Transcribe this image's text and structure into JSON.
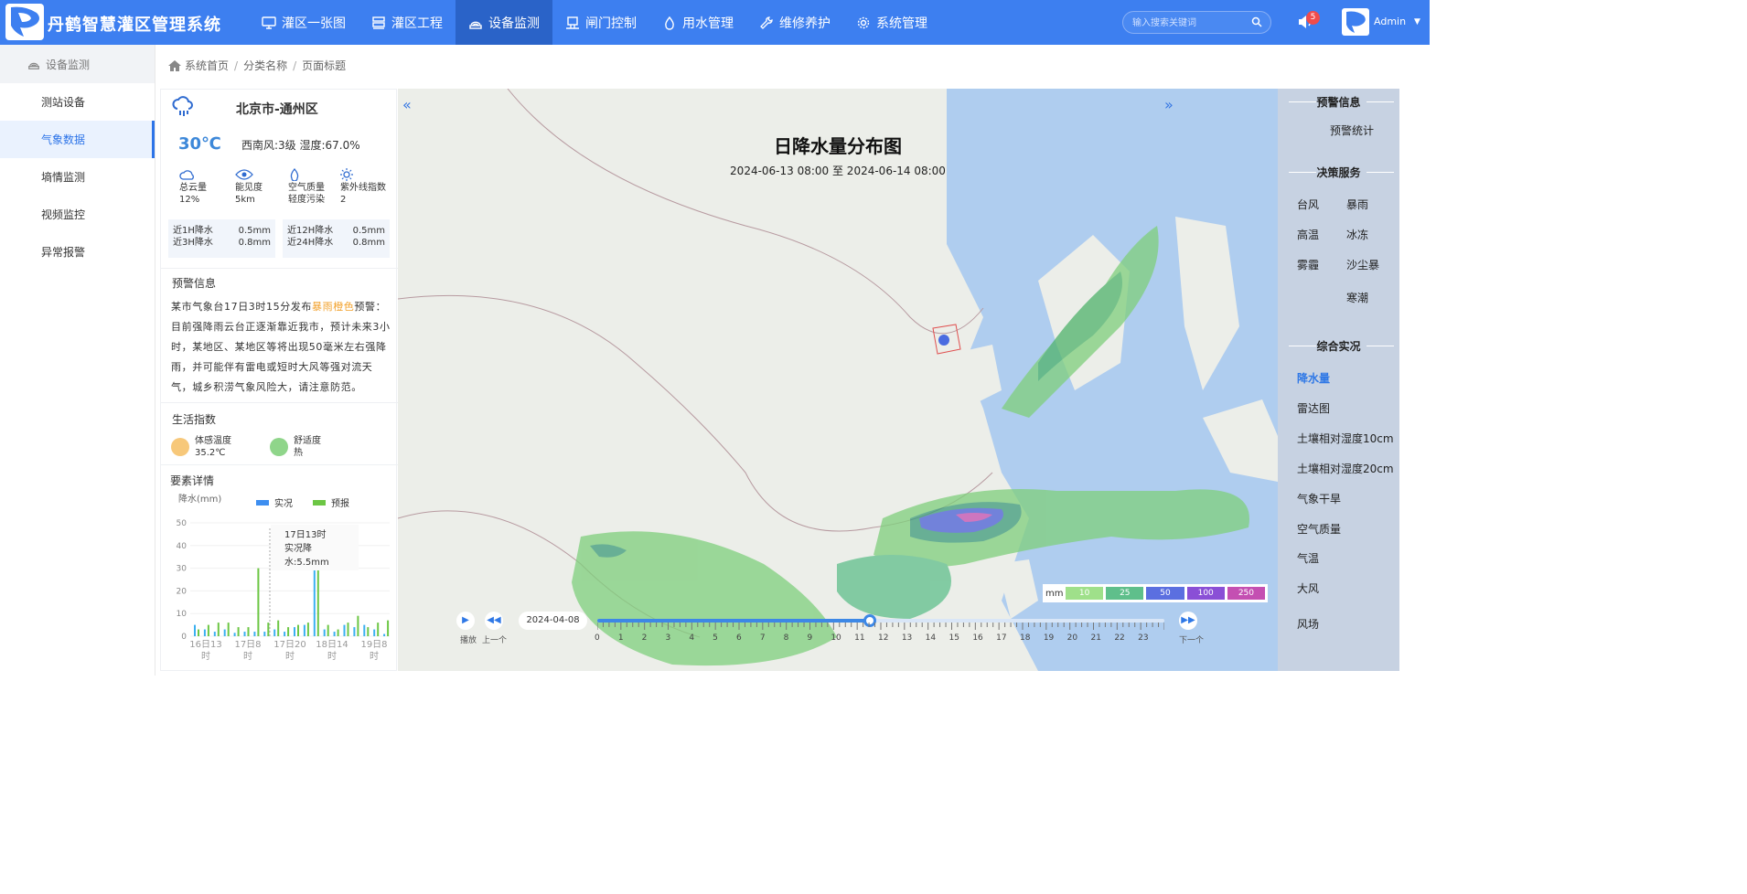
{
  "app": {
    "title": "丹鹤智慧灌区管理系统"
  },
  "nav": [
    {
      "label": "灌区一张图",
      "icon": "monitor-icon"
    },
    {
      "label": "灌区工程",
      "icon": "server-icon"
    },
    {
      "label": "设备监测",
      "icon": "broadcast-icon",
      "active": true
    },
    {
      "label": "闸门控制",
      "icon": "gate-icon"
    },
    {
      "label": "用水管理",
      "icon": "water-drop-icon"
    },
    {
      "label": "维修养护",
      "icon": "wrench-icon"
    },
    {
      "label": "系统管理",
      "icon": "gear-icon"
    }
  ],
  "search": {
    "placeholder": "输入搜索关键词"
  },
  "notifications": {
    "count": "5"
  },
  "user": {
    "name": "Admin"
  },
  "sidebar": {
    "header": "设备监测",
    "items": [
      {
        "label": "测站设备"
      },
      {
        "label": "气象数据",
        "active": true
      },
      {
        "label": "墒情监测"
      },
      {
        "label": "视频监控"
      },
      {
        "label": "异常报警"
      }
    ]
  },
  "breadcrumb": [
    "系统首页",
    "分类名称",
    "页面标题"
  ],
  "weather": {
    "location": "北京市-通州区",
    "temperature": "30℃",
    "wind_humidity": "西南风:3级 湿度:67.0%",
    "metrics": [
      {
        "label": "总云量",
        "value": "12%",
        "icon": "cloud-icon"
      },
      {
        "label": "能见度",
        "value": "5km",
        "icon": "eye-icon"
      },
      {
        "label": "空气质量",
        "value": "轻度污染",
        "icon": "air-icon"
      },
      {
        "label": "紫外线指数",
        "value": "2",
        "icon": "sun-icon"
      }
    ],
    "rain": [
      {
        "label": "近1H降水",
        "value": "0.5mm"
      },
      {
        "label": "近3H降水",
        "value": "0.8mm"
      },
      {
        "label": "近12H降水",
        "value": "0.5mm"
      },
      {
        "label": "近24H降水",
        "value": "0.8mm"
      }
    ]
  },
  "warning": {
    "title": "预警信息",
    "text_before": "某市气象台17日3时15分发布",
    "highlight": "暴雨橙色",
    "text_after": "预警：目前强降雨云台正逐渐靠近我市，预计未来3小时，某地区、某地区等将出现50毫米左右强降雨，并可能伴有雷电或短时大风等强对流天气，城乡积涝气象风险大，请注意防范。",
    "highlight_color": "#f2a12b"
  },
  "life": {
    "title": "生活指数",
    "items": [
      {
        "label": "体感温度",
        "value": "35.2℃",
        "color": "#f7c87a"
      },
      {
        "label": "舒适度",
        "value": "热",
        "color": "#8fd58a"
      }
    ]
  },
  "detail": {
    "title": "要素详情"
  },
  "chart_data": {
    "type": "bar",
    "ylabel": "降水(mm)",
    "ylim": [
      0,
      50
    ],
    "yticks": [
      0,
      10,
      20,
      30,
      40,
      50
    ],
    "xtick_labels": [
      "16日13时",
      "17日8时",
      "17日20时",
      "18日14时",
      "19日8时"
    ],
    "series": [
      {
        "name": "实况",
        "color": "#3bb0f0",
        "values": [
          5,
          3,
          2,
          3,
          1.5,
          2,
          2,
          2,
          3,
          2,
          4,
          5,
          34,
          3,
          2,
          5,
          4,
          5,
          3,
          1
        ]
      },
      {
        "name": "预报",
        "color": "#6cc644",
        "values": [
          3,
          5,
          6,
          6,
          4,
          4,
          30,
          6,
          7,
          4,
          5,
          6,
          30,
          5,
          3,
          6,
          9,
          4,
          6,
          7
        ]
      }
    ],
    "tooltip": {
      "title": "17日13时",
      "line1": "实况降",
      "line2": "水:5.5mm"
    }
  },
  "map": {
    "title": "日降水量分布图",
    "subtitle": "2024-06-13 08:00 至 2024-06-14 08:00",
    "scale": {
      "unit": "mm",
      "bins": [
        {
          "label": "10",
          "color": "#9fe08a"
        },
        {
          "label": "25",
          "color": "#5fbf8b"
        },
        {
          "label": "50",
          "color": "#5b6fe0"
        },
        {
          "label": "100",
          "color": "#8a4fd6"
        },
        {
          "label": "250",
          "color": "#c44fb2"
        }
      ]
    },
    "player": {
      "date": "2024-04-08",
      "play_label": "播放",
      "prev_label": "上一个",
      "next_label": "下一个",
      "hours": [
        "0",
        "1",
        "2",
        "3",
        "4",
        "5",
        "6",
        "7",
        "8",
        "9",
        "10",
        "11",
        "12",
        "13",
        "14",
        "15",
        "16",
        "17",
        "18",
        "19",
        "20",
        "21",
        "22",
        "23"
      ],
      "progress": 0.48
    }
  },
  "right": {
    "warning_title": "预警信息",
    "warning_item": "预警统计",
    "decision_title": "决策服务",
    "decision_items": [
      "台风",
      "暴雨",
      "高温",
      "冰冻",
      "雾霾",
      "沙尘暴",
      "寒潮"
    ],
    "overview_title": "综合实况",
    "overview_items": [
      "降水量",
      "雷达图",
      "土壤相对湿度10cm",
      "土壤相对湿度20cm",
      "气象干旱",
      "空气质量",
      "气温",
      "大风",
      "风场"
    ]
  }
}
